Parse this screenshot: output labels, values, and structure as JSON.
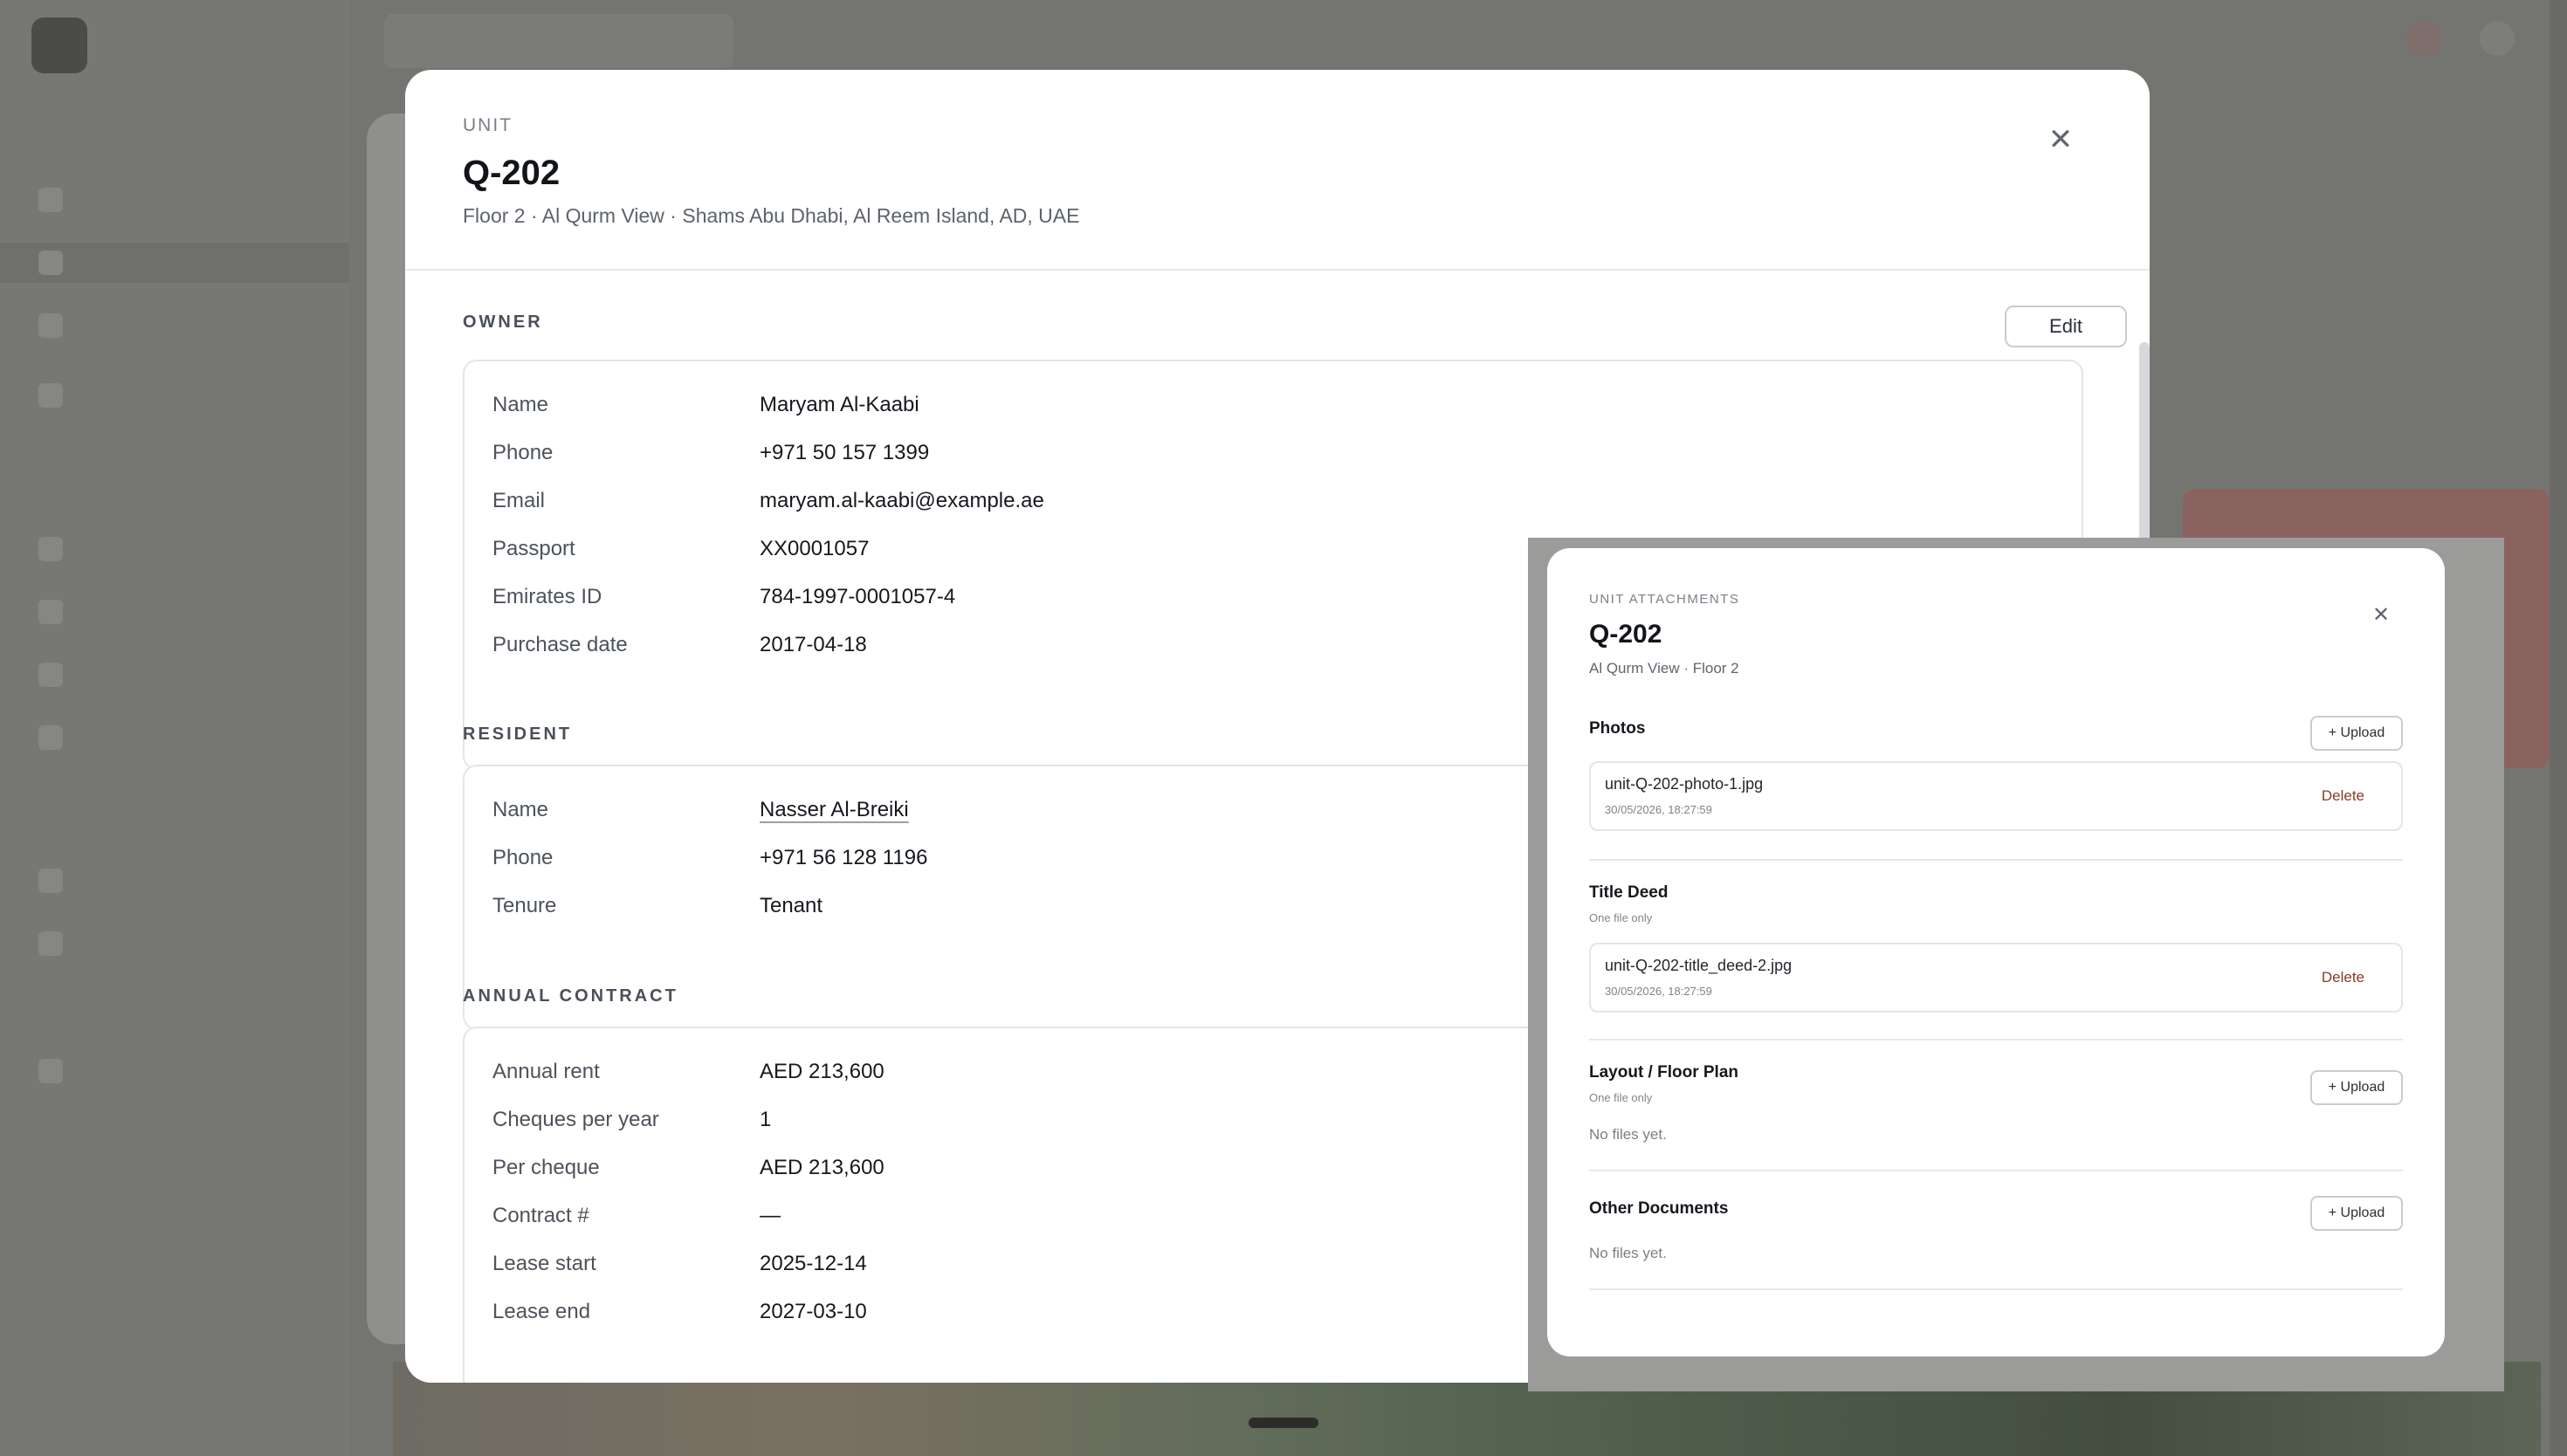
{
  "unit_modal": {
    "eyebrow": "UNIT",
    "title": "Q-202",
    "subtitle": "Floor 2 · Al Qurm View · Shams Abu Dhabi, Al Reem Island, AD, UAE",
    "edit_label": "Edit",
    "owner": {
      "label": "OWNER",
      "rows": [
        {
          "k": "Name",
          "v": "Maryam Al-Kaabi"
        },
        {
          "k": "Phone",
          "v": "+971 50 157 1399"
        },
        {
          "k": "Email",
          "v": "maryam.al-kaabi@example.ae"
        },
        {
          "k": "Passport",
          "v": "XX0001057"
        },
        {
          "k": "Emirates ID",
          "v": "784-1997-0001057-4"
        },
        {
          "k": "Purchase date",
          "v": "2017-04-18"
        }
      ]
    },
    "resident": {
      "label": "RESIDENT",
      "rows": [
        {
          "k": "Name",
          "v": "Nasser Al-Breiki"
        },
        {
          "k": "Phone",
          "v": "+971 56 128 1196"
        },
        {
          "k": "Tenure",
          "v": "Tenant"
        }
      ]
    },
    "contract": {
      "label": "ANNUAL CONTRACT",
      "rows": [
        {
          "k": "Annual rent",
          "v": "AED 213,600"
        },
        {
          "k": "Cheques per year",
          "v": "1"
        },
        {
          "k": "Per cheque",
          "v": "AED 213,600"
        },
        {
          "k": "Contract #",
          "v": "—"
        },
        {
          "k": "Lease start",
          "v": "2025-12-14"
        },
        {
          "k": "Lease end",
          "v": "2027-03-10"
        }
      ]
    }
  },
  "attachments": {
    "eyebrow": "UNIT ATTACHMENTS",
    "title": "Q-202",
    "subtitle": "Al Qurm View · Floor 2",
    "upload_label": "+ Upload",
    "delete_label": "Delete",
    "one_file_note": "One file only",
    "empty_text": "No files yet.",
    "photos": {
      "heading": "Photos",
      "file": {
        "name": "unit-Q-202-photo-1.jpg",
        "date": "30/05/2026, 18:27:59"
      }
    },
    "title_deed": {
      "heading": "Title Deed",
      "file": {
        "name": "unit-Q-202-title_deed-2.jpg",
        "date": "30/05/2026, 18:27:59"
      }
    },
    "layout": {
      "heading": "Layout / Floor Plan"
    },
    "other": {
      "heading": "Other Documents"
    }
  }
}
